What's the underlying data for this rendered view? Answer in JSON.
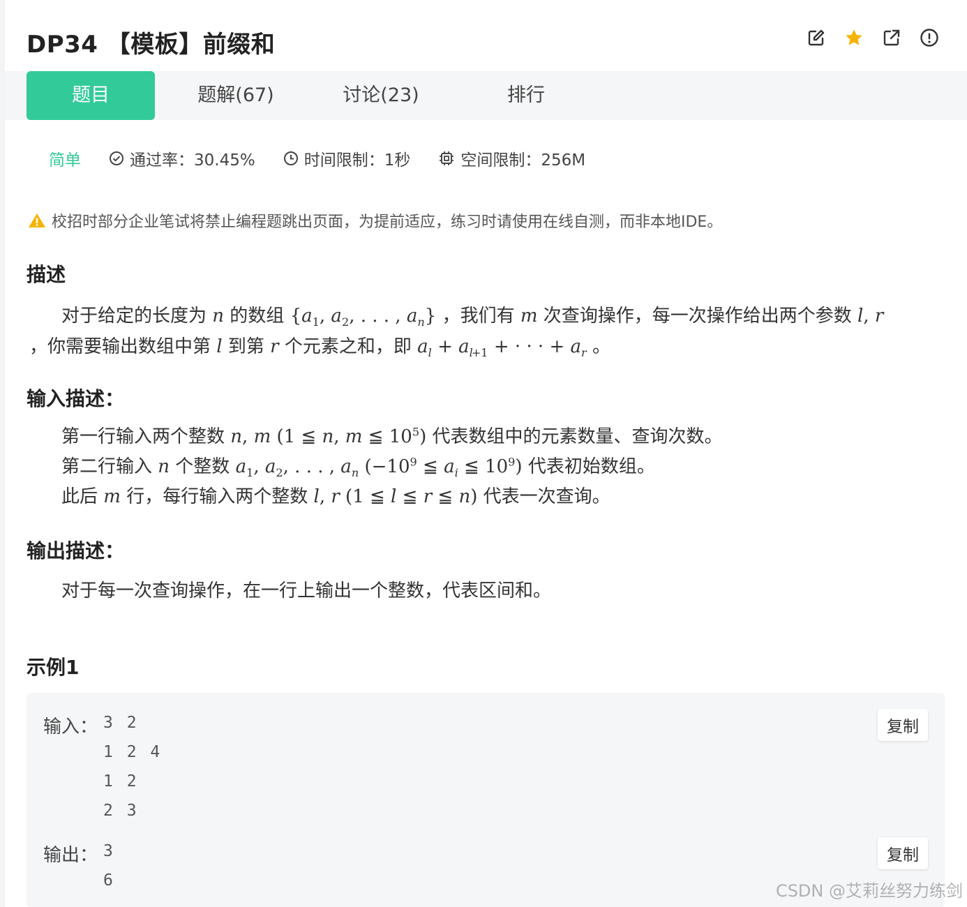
{
  "header": {
    "title": "DP34  【模板】前缀和"
  },
  "header_icons": [
    "edit-icon",
    "star-icon",
    "external-link-icon",
    "report-icon"
  ],
  "colors": {
    "accent": "#32ca99",
    "star": "#f5b400",
    "warning": "#f5b400"
  },
  "tabs": [
    {
      "label": "题目",
      "active": true
    },
    {
      "label": "题解(67)",
      "active": false
    },
    {
      "label": "讨论(23)",
      "active": false
    },
    {
      "label": "排行",
      "active": false
    }
  ],
  "meta": {
    "difficulty": "简单",
    "pass_rate": "通过率：30.45%",
    "time_limit": "时间限制：1秒",
    "memory_limit": "空间限制：256M"
  },
  "warning": "校招时部分企业笔试将禁止编程题跳出页面，为提前适应，练习时请使用在线自测，而非本地IDE。",
  "description": {
    "heading": "描述",
    "t1": "对于给定的长度为",
    "t2": "的数组",
    "t3": "，我们有",
    "t4": "次查询操作，每一次操作给出两个参数",
    "t5": "，你需要输出数组中第",
    "t6": "到第",
    "t7": "个元素之和，即",
    "t8": "。"
  },
  "input_desc": {
    "heading": "输入描述：",
    "l1a": "第一行输入两个整数",
    "l1b": "代表数组中的元素数量、查询次数。",
    "l2a": "第二行输入",
    "l2b": "个整数",
    "l2c": "代表初始数组。",
    "l3a": "此后",
    "l3b": "行，每行输入两个整数",
    "l3c": "代表一次查询。"
  },
  "output_desc": {
    "heading": "输出描述：",
    "text": "对于每一次查询操作，在一行上输出一个整数，代表区间和。"
  },
  "example": {
    "heading": "示例1",
    "input_label": "输入：",
    "input_lines": [
      "3 2",
      "1 2 4",
      "1 2",
      "2 3"
    ],
    "output_label": "输出：",
    "output_lines": [
      "3",
      "6"
    ],
    "copy_label": "复制"
  },
  "watermark": "CSDN @艾莉丝努力练剑"
}
